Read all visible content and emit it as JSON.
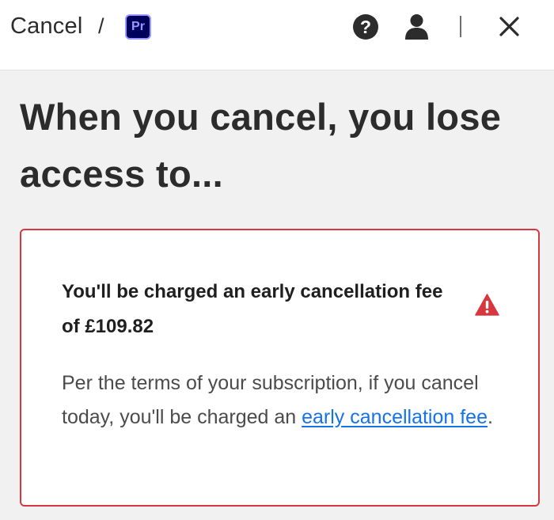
{
  "header": {
    "breadcrumb_label": "Cancel",
    "breadcrumb_separator": "/",
    "app_badge_text": "Pr",
    "icons": [
      "help-icon",
      "user-icon",
      "close-icon"
    ]
  },
  "main": {
    "title": "When you cancel, you lose access to..."
  },
  "alert": {
    "heading": "You'll be charged an early cancellation fee of £109.82",
    "body_text": "Per the terms of your subscription, if you cancel today, you'll be charged an ",
    "link_text": "early cancellation fee",
    "body_suffix": ".",
    "icon": "warning-icon"
  },
  "colors": {
    "alert_border": "#d7373f",
    "link": "#1473e6",
    "app_badge_bg": "#00005b",
    "app_badge_fg": "#9999ff",
    "page_bg": "#f1f1f1"
  }
}
